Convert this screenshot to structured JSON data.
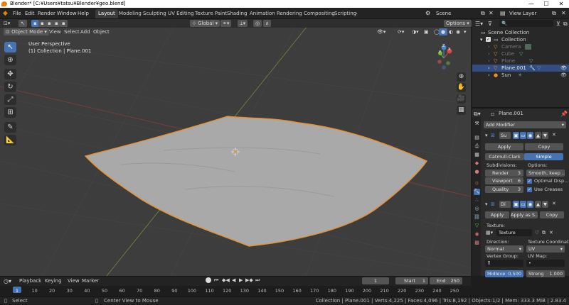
{
  "window": {
    "title": "Blender* [C:¥Users¥tatsu¥Blender¥geo.blend]",
    "min": "—",
    "max": "☐",
    "close": "✕"
  },
  "menu": {
    "file": "File",
    "edit": "Edit",
    "render": "Render",
    "window": "Window",
    "help": "Help"
  },
  "workspaces": [
    "Layout",
    "Modeling",
    "Sculpting",
    "UV Editing",
    "Texture Paint",
    "Shading",
    "Animation",
    "Rendering",
    "Compositing",
    "Scripting"
  ],
  "scene": {
    "label": "Scene",
    "view_layer": "View Layer"
  },
  "viewport_header": {
    "mode": "Object Mode",
    "view": "View",
    "select": "Select",
    "add": "Add",
    "object": "Object",
    "transform": "Global",
    "options": "Options"
  },
  "overlay": {
    "perspective": "User Perspective",
    "collection": "(1) Collection | Plane.001"
  },
  "gizmo": {
    "x": "X",
    "y": "Y",
    "z": "Z"
  },
  "outliner": {
    "scene_collection": "Scene Collection",
    "collection": "Collection",
    "items": [
      {
        "name": "Camera",
        "selected": false
      },
      {
        "name": "Cube",
        "selected": false
      },
      {
        "name": "Plane",
        "selected": false
      },
      {
        "name": "Plane.001",
        "selected": true
      },
      {
        "name": "Sun",
        "selected": false
      }
    ]
  },
  "properties": {
    "object_name": "Plane.001",
    "add_modifier": "Add Modifier",
    "mod1": {
      "name": "Su",
      "apply": "Apply",
      "copy": "Copy",
      "catmull": "Catmull-Clark",
      "simple": "Simple",
      "subdivisions": "Subdivisions:",
      "options": "Options:",
      "render_label": "Render",
      "render_val": "3",
      "viewport_label": "Viewport",
      "viewport_val": "6",
      "quality_label": "Quality",
      "quality_val": "3",
      "smooth": "Smooth, keep ...",
      "optimal": "Optimal Disp...",
      "creases": "Use Creases"
    },
    "mod2": {
      "name": "Di",
      "apply": "Apply",
      "apply_as": "Apply as S...",
      "copy": "Copy",
      "texture_label": "Texture:",
      "texture_val": "Texture",
      "direction_label": "Direction:",
      "direction_val": "Normal",
      "coords_label": "Texture Coordinat",
      "coords_val": "UV",
      "vgroup_label": "Vertex Group:",
      "uvmap_label": "UV Map:",
      "uvmap_val": "•",
      "midlevel_label": "Midleve",
      "midlevel_val": "0.500",
      "strength_label": "Streng",
      "strength_val": "1.000"
    }
  },
  "timeline": {
    "playback": "Playback",
    "keying": "Keying",
    "view": "View",
    "marker": "Marker",
    "current_frame": "1",
    "start_label": "Start",
    "start_val": "1",
    "end_label": "End",
    "end_val": "250",
    "ticks": [
      "1",
      "10",
      "20",
      "30",
      "40",
      "50",
      "60",
      "70",
      "80",
      "90",
      "100",
      "110",
      "120",
      "130",
      "140",
      "150",
      "160",
      "170",
      "180",
      "190",
      "200",
      "210",
      "220",
      "230",
      "240",
      "250"
    ]
  },
  "status": {
    "select": "Select",
    "center": "Center View to Mouse",
    "info": "Collection | Plane.001 | Verts:4,225 | Faces:4,096 | Tris:8,192 | Objects:1/2 | Mem: 333.3 MiB | 2.83.4"
  },
  "colors": {
    "accent": "#4772b3",
    "selection": "#334d80",
    "object_outline": "#e8902d",
    "mesh": "#a8a8a8"
  }
}
